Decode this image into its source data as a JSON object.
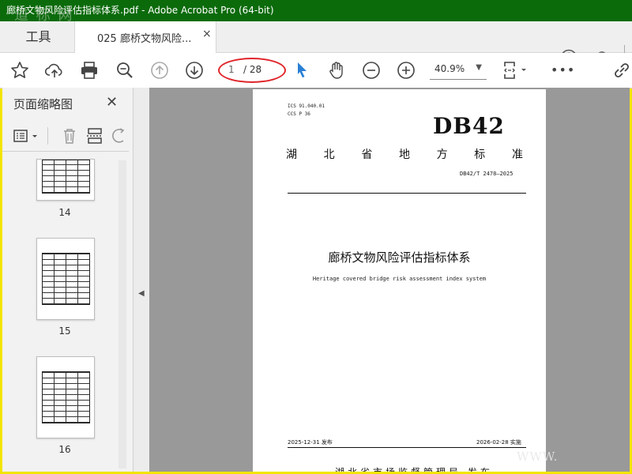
{
  "window": {
    "title": "廊桥文物风险评估指标体系.pdf - Adobe Acrobat Pro (64-bit)",
    "watermark": "道 标 网"
  },
  "tabs": {
    "tools_label": "工具",
    "doc_label": "025 廊桥文物风险...",
    "close": "×"
  },
  "toolbar": {
    "page_current": "1",
    "page_total": "/ 28",
    "zoom": "40.9%",
    "more": "•••"
  },
  "sidebar": {
    "title": "页面缩略图",
    "close": "✕",
    "thumbnails": [
      {
        "num": "14"
      },
      {
        "num": "15"
      },
      {
        "num": "16"
      }
    ]
  },
  "document": {
    "ics": "ICS  91.040.01",
    "ccs": "CCS  P 36",
    "code": "DB42",
    "province": [
      "湖",
      "北",
      "省",
      "地",
      "方",
      "标",
      "准"
    ],
    "std_no": "DB42/T 2478—2025",
    "title_cn": "廊桥文物风险评估指标体系",
    "title_en": "Heritage covered bridge risk assessment index system",
    "publish_date": "2025-12-31 发布",
    "implement_date": "2026-02-28 实施",
    "issuer": "湖北省市场监督管理局  发布",
    "watermark_url": "WWW."
  },
  "colors": {
    "titlebar": "#0b6b0b",
    "frame": "#f2e500",
    "oval": "#e0262b",
    "cursor": "#2a7fd4"
  }
}
